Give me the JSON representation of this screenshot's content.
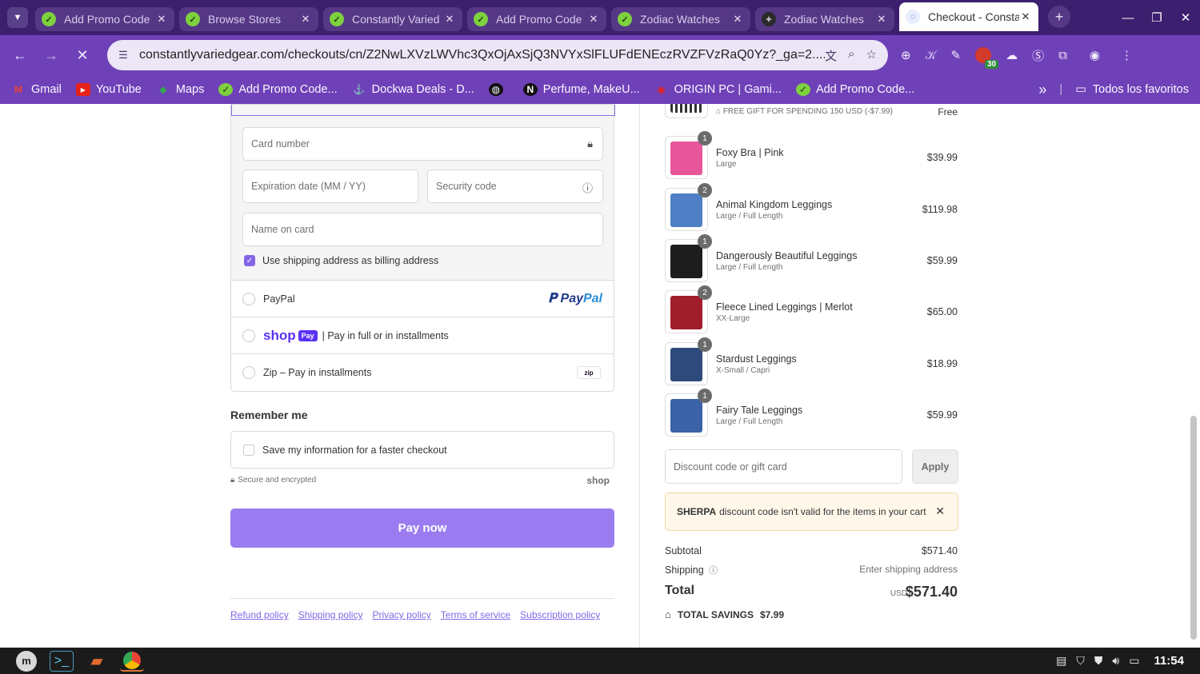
{
  "browser": {
    "tabs": [
      {
        "title": "Add Promo Code",
        "favicon": "promo-check-icon"
      },
      {
        "title": "Browse Stores",
        "favicon": "promo-check-icon"
      },
      {
        "title": "Constantly Varied",
        "favicon": "promo-check-icon"
      },
      {
        "title": "Add Promo Code",
        "favicon": "promo-check-icon"
      },
      {
        "title": "Zodiac Watches",
        "favicon": "promo-check-icon"
      },
      {
        "title": "Zodiac Watches",
        "favicon": "gear-icon"
      },
      {
        "title": "Checkout - Constantly",
        "favicon": "loading-icon",
        "active": true
      }
    ],
    "url": "constantlyvariedgear.com/checkouts/cn/Z2NwLXVzLWVhc3QxOjAxSjQ3NVYxSlFLUFdENEczRVZFVzRaQ0Yz?_ga=2....",
    "extension_badge": "30",
    "bookmarks": [
      {
        "label": "Gmail",
        "icon": "gmail-icon"
      },
      {
        "label": "YouTube",
        "icon": "youtube-icon"
      },
      {
        "label": "Maps",
        "icon": "maps-icon"
      },
      {
        "label": "Add Promo Code...",
        "icon": "promo-check-icon"
      },
      {
        "label": "Dockwa Deals - D...",
        "icon": "dockwa-icon"
      },
      {
        "label": "",
        "icon": "globe-icon"
      },
      {
        "label": "Perfume, MakeU...",
        "icon": "n-icon"
      },
      {
        "label": "ORIGIN PC | Gami...",
        "icon": "origin-icon"
      },
      {
        "label": "Add Promo Code...",
        "icon": "promo-check-icon"
      }
    ],
    "all_bookmarks": "Todos los favoritos",
    "more_bookmarks": "»"
  },
  "payment": {
    "card_number_placeholder": "Card number",
    "expiry_placeholder": "Expiration date (MM / YY)",
    "security_placeholder": "Security code",
    "name_placeholder": "Name on card",
    "billing_label": "Use shipping address as billing address",
    "billing_checked": true,
    "paypal_label": "PayPal",
    "paypal_logo_a": "Pay",
    "paypal_logo_b": "Pal",
    "shop_word": "shop",
    "shop_pay_badge": "Pay",
    "shop_pay_label": "| Pay in full or in installments",
    "zip_label": "Zip – Pay in installments",
    "zip_logo": "zip"
  },
  "remember": {
    "heading": "Remember me",
    "save_label": "Save my information for a faster checkout",
    "secure_label": "Secure and encrypted",
    "shop_brand": "shop"
  },
  "pay_now": "Pay now",
  "policies": [
    "Refund policy",
    "Shipping policy",
    "Privacy policy",
    "Terms of service",
    "Subscription policy"
  ],
  "summary": {
    "gift": {
      "label": "FREE GIFT FOR SPENDING 150 USD (-$7.99)",
      "price": "Free"
    },
    "items": [
      {
        "qty": "1",
        "name": "Foxy Bra | Pink",
        "variant": "Large",
        "price": "$39.99",
        "color": "#e8579a"
      },
      {
        "qty": "2",
        "name": "Animal Kingdom Leggings",
        "variant": "Large / Full Length",
        "price": "$119.98",
        "color": "#4f7fc4"
      },
      {
        "qty": "1",
        "name": "Dangerously Beautiful Leggings",
        "variant": "Large / Full Length",
        "price": "$59.99",
        "color": "#1d1d1d"
      },
      {
        "qty": "2",
        "name": "Fleece Lined Leggings | Merlot",
        "variant": "XX-Large",
        "price": "$65.00",
        "color": "#a01d2c"
      },
      {
        "qty": "1",
        "name": "Stardust Leggings",
        "variant": "X-Small / Capri",
        "price": "$18.99",
        "color": "#2e4a7a"
      },
      {
        "qty": "1",
        "name": "Fairy Tale Leggings",
        "variant": "Large / Full Length",
        "price": "$59.99",
        "color": "#3c63a8"
      }
    ],
    "discount_placeholder": "Discount code or gift card",
    "apply_label": "Apply",
    "alert_code": "SHERPA",
    "alert_text": "discount code isn't valid for the items in your cart",
    "subtotal_label": "Subtotal",
    "subtotal_value": "$571.40",
    "shipping_label": "Shipping",
    "shipping_value": "Enter shipping address",
    "total_label": "Total",
    "total_currency": "USD",
    "total_value": "$571.40",
    "savings_label": "TOTAL SAVINGS",
    "savings_value": "$7.99"
  },
  "taskbar": {
    "clock": "11:54"
  },
  "colors": {
    "accent": "#9b7cf0",
    "link": "#8465e8",
    "browser_frame": "#6f41b8",
    "tab_strip": "#3c1f6e"
  }
}
